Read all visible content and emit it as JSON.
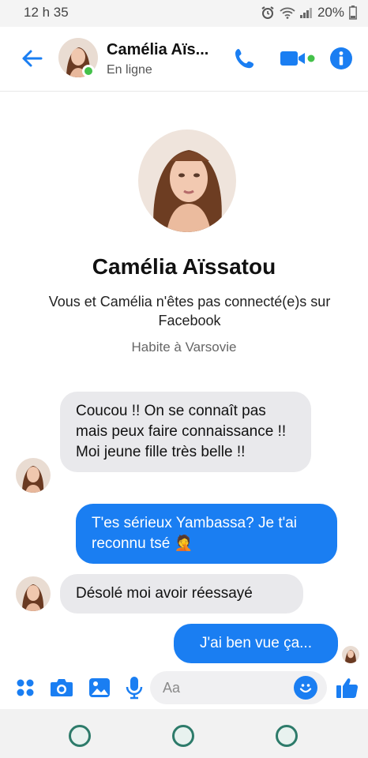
{
  "status_bar": {
    "time": "12 h 35",
    "battery": "20%"
  },
  "header": {
    "contact_name": "Camélia Aïs...",
    "status": "En ligne"
  },
  "profile": {
    "name": "Camélia Aïssatou",
    "connection_note": "Vous et Camélia n'êtes pas connecté(e)s sur Facebook",
    "location": "Habite à Varsovie"
  },
  "messages": [
    {
      "direction": "incoming",
      "text": "Coucou !! On se connaît pas mais peux faire connaissance !! Moi jeune fille très belle !!"
    },
    {
      "direction": "outgoing",
      "text": "T'es sérieux Yambassa? Je t'ai reconnu tsé 🤦"
    },
    {
      "direction": "incoming",
      "text": "Désolé moi avoir réessayé"
    },
    {
      "direction": "outgoing",
      "text": "J'ai ben vue ça..."
    }
  ],
  "composer": {
    "placeholder": "Aa",
    "value": ""
  },
  "icons": {
    "header": [
      "back-arrow-icon",
      "phone-icon",
      "video-camera-icon",
      "info-icon"
    ],
    "composer": [
      "apps-grid-icon",
      "camera-icon",
      "image-icon",
      "microphone-icon",
      "emoji-icon",
      "thumbs-up-icon"
    ],
    "status": [
      "alarm-icon",
      "wifi-icon",
      "signal-icon",
      "battery-icon"
    ]
  },
  "colors": {
    "accent": "#1a7ef2",
    "incoming_bubble": "#e9e9ec",
    "online": "#44c14a"
  }
}
